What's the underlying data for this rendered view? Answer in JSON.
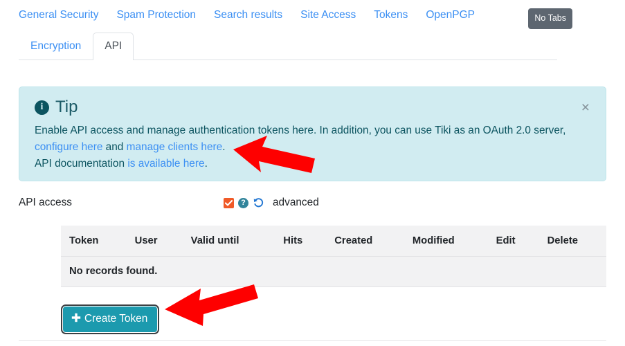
{
  "topnav": {
    "links": [
      {
        "label": "General Security"
      },
      {
        "label": "Spam Protection"
      },
      {
        "label": "Search results"
      },
      {
        "label": "Site Access"
      },
      {
        "label": "Tokens"
      },
      {
        "label": "OpenPGP"
      }
    ],
    "no_tabs_label": "No Tabs"
  },
  "tabs": [
    {
      "label": "Encryption",
      "active": false
    },
    {
      "label": "API",
      "active": true
    }
  ],
  "tip": {
    "icon": "info-circle-icon",
    "title": "Tip",
    "close_label": "×",
    "line1_a": "Enable API access and manage authentication tokens here. In addition, you can use Tiki as an OAuth 2.0 server,",
    "line2_link1": "configure here",
    "line2_mid": " and ",
    "line2_link2": "manage clients here",
    "line2_end": ".",
    "line3_a": "API documentation ",
    "line3_link": "is available here",
    "line3_end": "."
  },
  "api_access": {
    "label": "API access",
    "checkbox_checked": true,
    "help_glyph": "?",
    "undo_icon": "undo-arrow-icon",
    "advanced_label": "advanced"
  },
  "table": {
    "columns": [
      "Token",
      "User",
      "Valid until",
      "Hits",
      "Created",
      "Modified",
      "Edit",
      "Delete"
    ],
    "rows": [],
    "empty_message": "No records found."
  },
  "create_button": {
    "plus": "＋",
    "label": "Create Token"
  },
  "colors": {
    "link": "#3b8ff3",
    "tip_bg": "#d1ecf1",
    "tip_text": "#0c5460",
    "checkbox": "#f05a28",
    "help": "#31849b",
    "undo": "#2176d2",
    "button": "#1c9aae",
    "no_tabs": "#5d6670",
    "arrow": "#fe0000",
    "table_bg": "#f2f2f3"
  }
}
